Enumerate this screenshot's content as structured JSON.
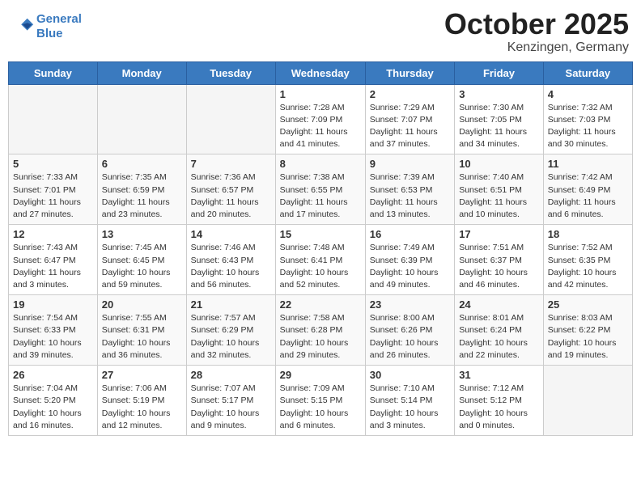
{
  "header": {
    "logo_line1": "General",
    "logo_line2": "Blue",
    "month": "October 2025",
    "location": "Kenzingen, Germany"
  },
  "weekdays": [
    "Sunday",
    "Monday",
    "Tuesday",
    "Wednesday",
    "Thursday",
    "Friday",
    "Saturday"
  ],
  "weeks": [
    [
      {
        "day": "",
        "info": ""
      },
      {
        "day": "",
        "info": ""
      },
      {
        "day": "",
        "info": ""
      },
      {
        "day": "1",
        "info": "Sunrise: 7:28 AM\nSunset: 7:09 PM\nDaylight: 11 hours\nand 41 minutes."
      },
      {
        "day": "2",
        "info": "Sunrise: 7:29 AM\nSunset: 7:07 PM\nDaylight: 11 hours\nand 37 minutes."
      },
      {
        "day": "3",
        "info": "Sunrise: 7:30 AM\nSunset: 7:05 PM\nDaylight: 11 hours\nand 34 minutes."
      },
      {
        "day": "4",
        "info": "Sunrise: 7:32 AM\nSunset: 7:03 PM\nDaylight: 11 hours\nand 30 minutes."
      }
    ],
    [
      {
        "day": "5",
        "info": "Sunrise: 7:33 AM\nSunset: 7:01 PM\nDaylight: 11 hours\nand 27 minutes."
      },
      {
        "day": "6",
        "info": "Sunrise: 7:35 AM\nSunset: 6:59 PM\nDaylight: 11 hours\nand 23 minutes."
      },
      {
        "day": "7",
        "info": "Sunrise: 7:36 AM\nSunset: 6:57 PM\nDaylight: 11 hours\nand 20 minutes."
      },
      {
        "day": "8",
        "info": "Sunrise: 7:38 AM\nSunset: 6:55 PM\nDaylight: 11 hours\nand 17 minutes."
      },
      {
        "day": "9",
        "info": "Sunrise: 7:39 AM\nSunset: 6:53 PM\nDaylight: 11 hours\nand 13 minutes."
      },
      {
        "day": "10",
        "info": "Sunrise: 7:40 AM\nSunset: 6:51 PM\nDaylight: 11 hours\nand 10 minutes."
      },
      {
        "day": "11",
        "info": "Sunrise: 7:42 AM\nSunset: 6:49 PM\nDaylight: 11 hours\nand 6 minutes."
      }
    ],
    [
      {
        "day": "12",
        "info": "Sunrise: 7:43 AM\nSunset: 6:47 PM\nDaylight: 11 hours\nand 3 minutes."
      },
      {
        "day": "13",
        "info": "Sunrise: 7:45 AM\nSunset: 6:45 PM\nDaylight: 10 hours\nand 59 minutes."
      },
      {
        "day": "14",
        "info": "Sunrise: 7:46 AM\nSunset: 6:43 PM\nDaylight: 10 hours\nand 56 minutes."
      },
      {
        "day": "15",
        "info": "Sunrise: 7:48 AM\nSunset: 6:41 PM\nDaylight: 10 hours\nand 52 minutes."
      },
      {
        "day": "16",
        "info": "Sunrise: 7:49 AM\nSunset: 6:39 PM\nDaylight: 10 hours\nand 49 minutes."
      },
      {
        "day": "17",
        "info": "Sunrise: 7:51 AM\nSunset: 6:37 PM\nDaylight: 10 hours\nand 46 minutes."
      },
      {
        "day": "18",
        "info": "Sunrise: 7:52 AM\nSunset: 6:35 PM\nDaylight: 10 hours\nand 42 minutes."
      }
    ],
    [
      {
        "day": "19",
        "info": "Sunrise: 7:54 AM\nSunset: 6:33 PM\nDaylight: 10 hours\nand 39 minutes."
      },
      {
        "day": "20",
        "info": "Sunrise: 7:55 AM\nSunset: 6:31 PM\nDaylight: 10 hours\nand 36 minutes."
      },
      {
        "day": "21",
        "info": "Sunrise: 7:57 AM\nSunset: 6:29 PM\nDaylight: 10 hours\nand 32 minutes."
      },
      {
        "day": "22",
        "info": "Sunrise: 7:58 AM\nSunset: 6:28 PM\nDaylight: 10 hours\nand 29 minutes."
      },
      {
        "day": "23",
        "info": "Sunrise: 8:00 AM\nSunset: 6:26 PM\nDaylight: 10 hours\nand 26 minutes."
      },
      {
        "day": "24",
        "info": "Sunrise: 8:01 AM\nSunset: 6:24 PM\nDaylight: 10 hours\nand 22 minutes."
      },
      {
        "day": "25",
        "info": "Sunrise: 8:03 AM\nSunset: 6:22 PM\nDaylight: 10 hours\nand 19 minutes."
      }
    ],
    [
      {
        "day": "26",
        "info": "Sunrise: 7:04 AM\nSunset: 5:20 PM\nDaylight: 10 hours\nand 16 minutes."
      },
      {
        "day": "27",
        "info": "Sunrise: 7:06 AM\nSunset: 5:19 PM\nDaylight: 10 hours\nand 12 minutes."
      },
      {
        "day": "28",
        "info": "Sunrise: 7:07 AM\nSunset: 5:17 PM\nDaylight: 10 hours\nand 9 minutes."
      },
      {
        "day": "29",
        "info": "Sunrise: 7:09 AM\nSunset: 5:15 PM\nDaylight: 10 hours\nand 6 minutes."
      },
      {
        "day": "30",
        "info": "Sunrise: 7:10 AM\nSunset: 5:14 PM\nDaylight: 10 hours\nand 3 minutes."
      },
      {
        "day": "31",
        "info": "Sunrise: 7:12 AM\nSunset: 5:12 PM\nDaylight: 10 hours\nand 0 minutes."
      },
      {
        "day": "",
        "info": ""
      }
    ]
  ]
}
